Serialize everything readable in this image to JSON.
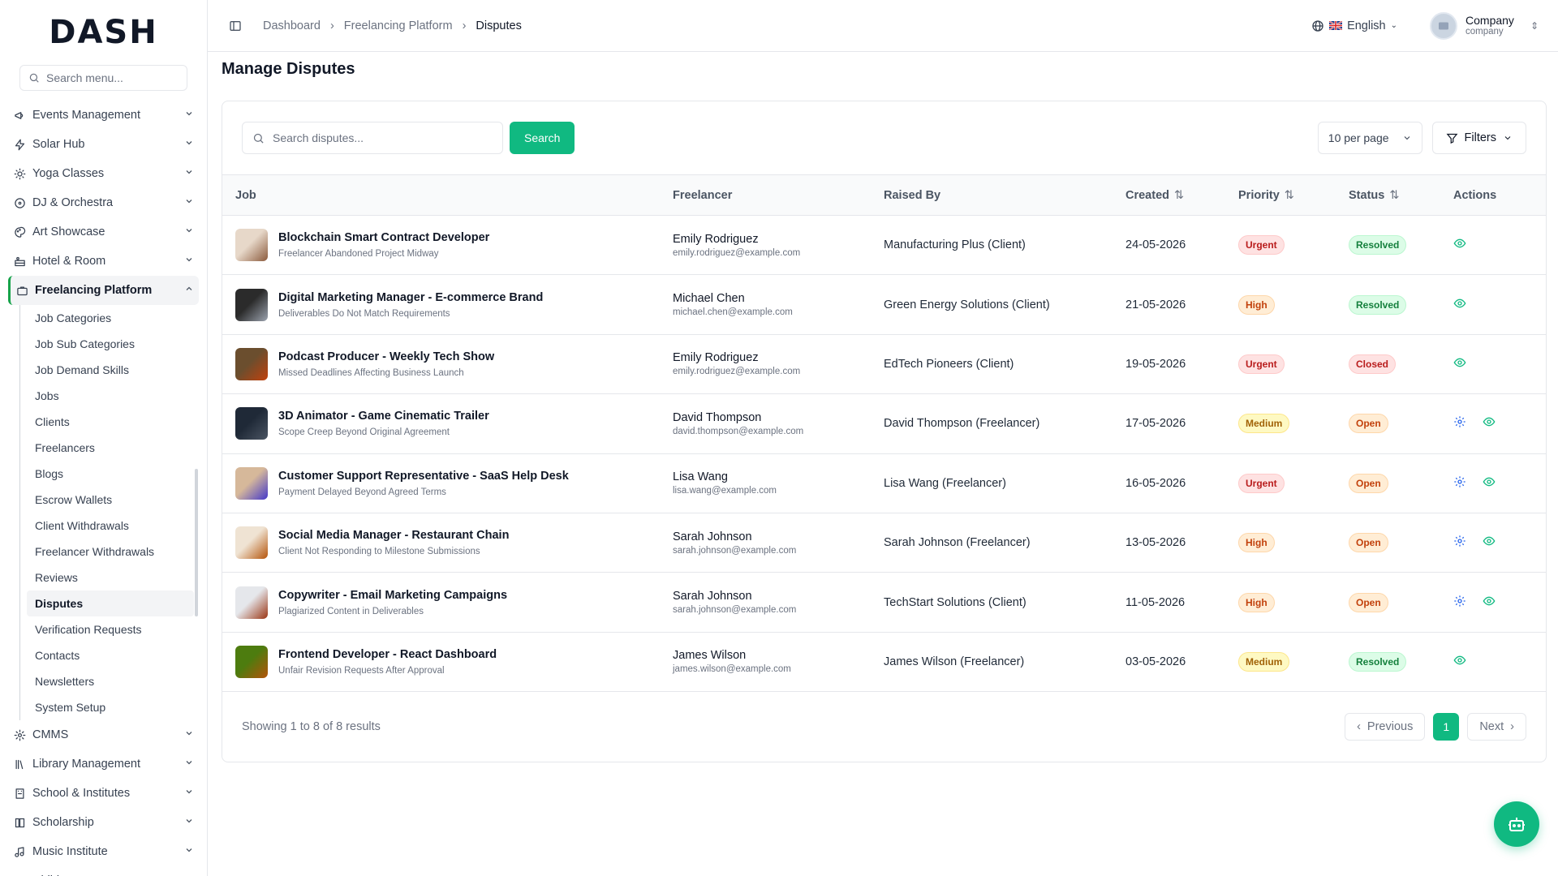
{
  "logo": "DASH",
  "sidebar": {
    "search_placeholder": "Search menu...",
    "items": [
      {
        "label": "Events Management",
        "icon": "megaphone-icon"
      },
      {
        "label": "Solar Hub",
        "icon": "bolt-icon"
      },
      {
        "label": "Yoga Classes",
        "icon": "sun-icon"
      },
      {
        "label": "DJ & Orchestra",
        "icon": "disc-icon"
      },
      {
        "label": "Art Showcase",
        "icon": "palette-icon"
      },
      {
        "label": "Hotel & Room",
        "icon": "hotel-icon"
      },
      {
        "label": "Freelancing Platform",
        "icon": "briefcase-icon"
      }
    ],
    "sub_items": [
      "Job Categories",
      "Job Sub Categories",
      "Job Demand Skills",
      "Jobs",
      "Clients",
      "Freelancers",
      "Blogs",
      "Escrow Wallets",
      "Client Withdrawals",
      "Freelancer Withdrawals",
      "Reviews",
      "Disputes",
      "Verification Requests",
      "Contacts",
      "Newsletters",
      "System Setup"
    ],
    "items_after": [
      {
        "label": "CMMS",
        "icon": "gear-icon"
      },
      {
        "label": "Library Management",
        "icon": "library-icon"
      },
      {
        "label": "School & Institutes",
        "icon": "building-icon"
      },
      {
        "label": "Scholarship",
        "icon": "book-icon"
      },
      {
        "label": "Music Institute",
        "icon": "music-icon"
      },
      {
        "label": "Childcare",
        "icon": "child-icon"
      }
    ]
  },
  "header": {
    "breadcrumb": [
      "Dashboard",
      "Freelancing Platform",
      "Disputes"
    ],
    "language": "English",
    "user_name": "Company",
    "user_role": "company"
  },
  "page_title": "Manage Disputes",
  "toolbar": {
    "search_placeholder": "Search disputes...",
    "search_button": "Search",
    "per_page": "10 per page",
    "filters": "Filters"
  },
  "table": {
    "columns": [
      "Job",
      "Freelancer",
      "Raised By",
      "Created",
      "Priority",
      "Status",
      "Actions"
    ],
    "rows": [
      {
        "title": "Blockchain Smart Contract Developer",
        "subtitle": "Freelancer Abandoned Project Midway",
        "freelancer": "Emily Rodriguez",
        "email": "emily.rodriguez@example.com",
        "raised_by": "Manufacturing Plus (Client)",
        "created": "24-05-2026",
        "priority": "Urgent",
        "status": "Resolved",
        "settings": false
      },
      {
        "title": "Digital Marketing Manager - E-commerce Brand",
        "subtitle": "Deliverables Do Not Match Requirements",
        "freelancer": "Michael Chen",
        "email": "michael.chen@example.com",
        "raised_by": "Green Energy Solutions (Client)",
        "created": "21-05-2026",
        "priority": "High",
        "status": "Resolved",
        "settings": false
      },
      {
        "title": "Podcast Producer - Weekly Tech Show",
        "subtitle": "Missed Deadlines Affecting Business Launch",
        "freelancer": "Emily Rodriguez",
        "email": "emily.rodriguez@example.com",
        "raised_by": "EdTech Pioneers (Client)",
        "created": "19-05-2026",
        "priority": "Urgent",
        "status": "Closed",
        "settings": false
      },
      {
        "title": "3D Animator - Game Cinematic Trailer",
        "subtitle": "Scope Creep Beyond Original Agreement",
        "freelancer": "David Thompson",
        "email": "david.thompson@example.com",
        "raised_by": "David Thompson (Freelancer)",
        "created": "17-05-2026",
        "priority": "Medium",
        "status": "Open",
        "settings": true
      },
      {
        "title": "Customer Support Representative - SaaS Help Desk",
        "subtitle": "Payment Delayed Beyond Agreed Terms",
        "freelancer": "Lisa Wang",
        "email": "lisa.wang@example.com",
        "raised_by": "Lisa Wang (Freelancer)",
        "created": "16-05-2026",
        "priority": "Urgent",
        "status": "Open",
        "settings": true
      },
      {
        "title": "Social Media Manager - Restaurant Chain",
        "subtitle": "Client Not Responding to Milestone Submissions",
        "freelancer": "Sarah Johnson",
        "email": "sarah.johnson@example.com",
        "raised_by": "Sarah Johnson (Freelancer)",
        "created": "13-05-2026",
        "priority": "High",
        "status": "Open",
        "settings": true
      },
      {
        "title": "Copywriter - Email Marketing Campaigns",
        "subtitle": "Plagiarized Content in Deliverables",
        "freelancer": "Sarah Johnson",
        "email": "sarah.johnson@example.com",
        "raised_by": "TechStart Solutions (Client)",
        "created": "11-05-2026",
        "priority": "High",
        "status": "Open",
        "settings": true
      },
      {
        "title": "Frontend Developer - React Dashboard",
        "subtitle": "Unfair Revision Requests After Approval",
        "freelancer": "James Wilson",
        "email": "james.wilson@example.com",
        "raised_by": "James Wilson (Freelancer)",
        "created": "03-05-2026",
        "priority": "Medium",
        "status": "Resolved",
        "settings": false
      }
    ]
  },
  "footer": {
    "summary": "Showing 1 to 8 of 8 results",
    "previous": "Previous",
    "page": "1",
    "next": "Next"
  },
  "colors": {
    "accent": "#10b981",
    "active_border": "#16a34a"
  }
}
